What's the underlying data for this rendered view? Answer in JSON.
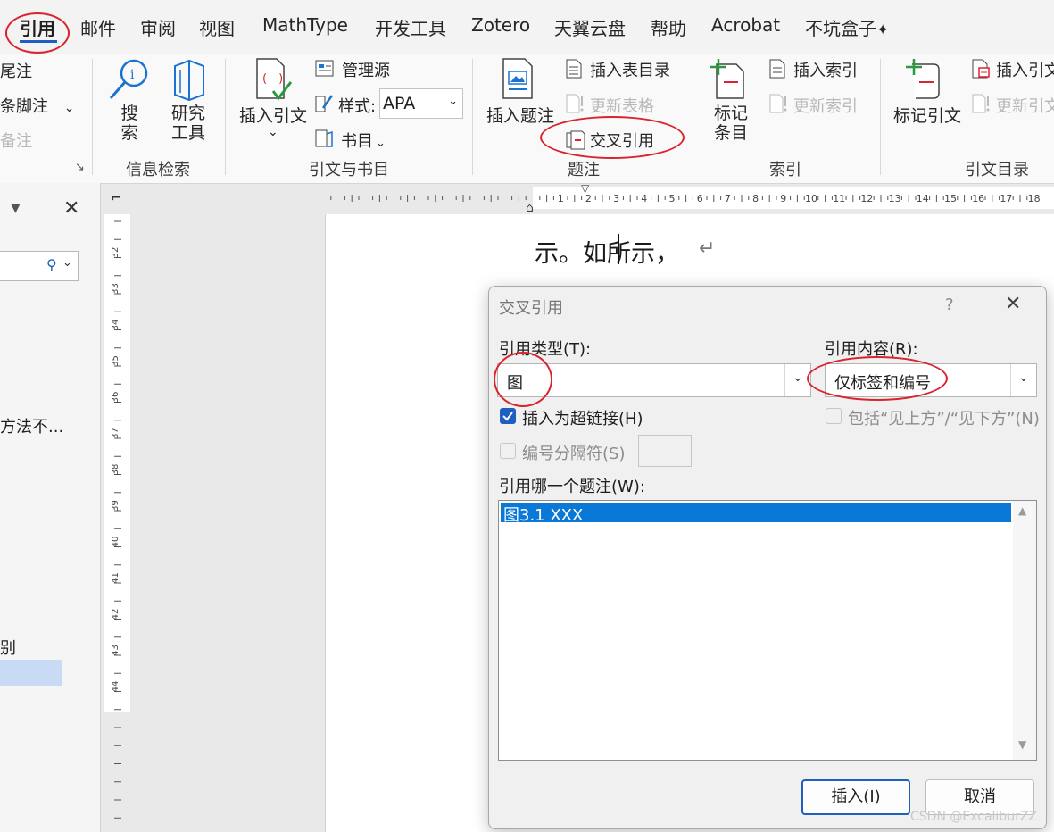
{
  "tabs": {
    "active": "引用",
    "mail": "邮件",
    "review": "审阅",
    "view": "视图",
    "mathtype": "MathType",
    "devtools": "开发工具",
    "zotero": "Zotero",
    "cloud": "天翼云盘",
    "help": "帮助",
    "acrobat": "Acrobat",
    "box": "不坑盒子"
  },
  "ribbon": {
    "footnotes": {
      "endnote": "尾注",
      "next_footnote": "条脚注",
      "notes": "备注"
    },
    "research": {
      "search": [
        "搜",
        "索"
      ],
      "research_tools": [
        "研究",
        "工具"
      ],
      "label": "信息检索"
    },
    "citations": {
      "insert_citation": "插入引文",
      "manage_sources": "管理源",
      "style_label": "样式:",
      "style_value": "APA",
      "bibliography": "书目",
      "label": "引文与书目"
    },
    "captions": {
      "insert_caption": "插入题注",
      "insert_table_of_figures": "插入表目录",
      "update_table": "更新表格",
      "cross_reference": "交叉引用",
      "label": "题注"
    },
    "index": {
      "mark_entry": [
        "标记",
        "条目"
      ],
      "insert_index": "插入索引",
      "update_index": "更新索引",
      "label": "索引"
    },
    "toa": {
      "mark_citation": "标记引文",
      "insert_toa": "插入引文",
      "update_toa": "更新引文",
      "label": "引文目录"
    }
  },
  "navpane": {
    "item_text": "方法不...",
    "item_text_2": "别"
  },
  "ruler": {
    "h_ticks": [
      "1",
      "2",
      "3",
      "4",
      "5",
      "6",
      "7",
      "8",
      "9",
      "10",
      "11",
      "12",
      "13",
      "14",
      "15",
      "16",
      "17",
      "18"
    ],
    "v_ticks": [
      "32",
      "33",
      "34",
      "35",
      "36",
      "37",
      "38",
      "39",
      "40",
      "41",
      "42",
      "43",
      "44"
    ]
  },
  "document": {
    "line_text": "示。如所示，"
  },
  "dialog": {
    "title": "交叉引用",
    "help": "?",
    "reference_type_label": "引用类型(T):",
    "reference_type_value": "图",
    "insert_reference_to_label": "引用内容(R):",
    "insert_reference_to_value": "仅标签和编号",
    "insert_as_hyperlink": "插入为超链接(H)",
    "include_above_below": "包括“见上方”/“见下方”(N)",
    "separate_numbers": "编号分隔符(S)",
    "for_which_caption_label": "引用哪一个题注(W):",
    "captions": [
      "图3.1 XXX"
    ],
    "insert_button": "插入(I)",
    "cancel_button": "取消"
  },
  "watermark": "CSDN @ExcaliburZZ",
  "colors": {
    "accent": "#1f5fbf",
    "annotation_red": "#d9232d",
    "selection": "#0a78d7",
    "nav_highlight": "#c8daf4"
  }
}
